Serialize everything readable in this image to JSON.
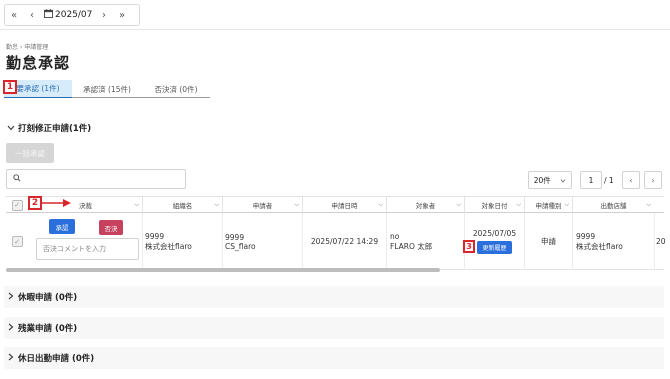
{
  "datenav": {
    "first": "«",
    "prev": "‹",
    "date": "2025/07",
    "next": "›",
    "last": "»"
  },
  "breadcrumb": {
    "home": "勤怠",
    "sep": "›",
    "current": "申請管理"
  },
  "page_title": "勤怠承認",
  "tabs": [
    {
      "label": "要承認 (1件)"
    },
    {
      "label": "承認済 (15件)"
    },
    {
      "label": "否決済 (0件)"
    }
  ],
  "markers": {
    "m1": "1",
    "m2": "2",
    "m3": "3"
  },
  "section_clock": {
    "label": "打刻修正申請(1件)"
  },
  "bulk_approve": "一括承認",
  "search": {
    "placeholder": ""
  },
  "pager": {
    "per_page": "20件",
    "page": "1",
    "total": "/ 1"
  },
  "columns": {
    "decision": "決裁",
    "org": "組織名",
    "applicant": "申請者",
    "applied_at": "申請日時",
    "target_person": "対象者",
    "target_date": "対象日付",
    "type": "申請種別",
    "store": "出勤店舗"
  },
  "row": {
    "approve": "承認",
    "reject": "否決",
    "comment_placeholder": "否決コメントを入力",
    "org_code": "9999",
    "org_name": "株式会社flaro",
    "applicant_code": "9999",
    "applicant_name": "CS_flaro",
    "applied_at": "2025/07/22 14:29",
    "target_no": "no",
    "target_name": "FLARO 太郎",
    "target_date": "2025/07/05",
    "history_button": "更新履歴",
    "type": "申請",
    "store_code": "9999",
    "store_name": "株式会社flaro",
    "overflow": "20"
  },
  "sections": [
    {
      "label": "休暇申請 (0件)"
    },
    {
      "label": "残業申請 (0件)"
    },
    {
      "label": "休日出勤申請 (0件)"
    }
  ],
  "colors": {
    "accent": "#2a6fdb",
    "reject": "#c7405e",
    "marker": "#d9262c",
    "tab_active_bg": "#d7ecfb"
  }
}
